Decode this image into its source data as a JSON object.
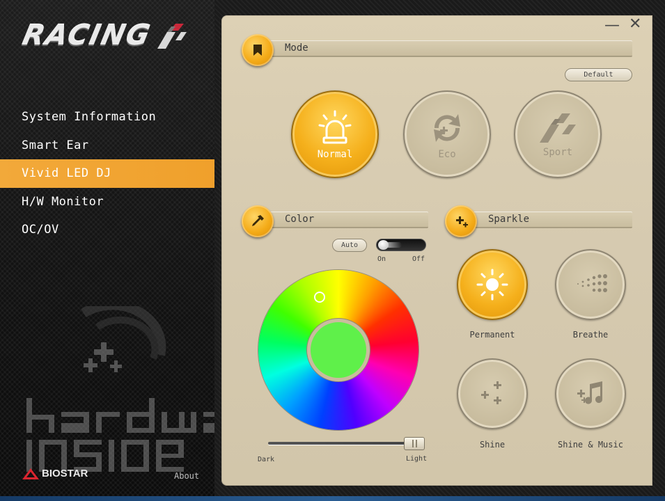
{
  "app": {
    "logo_text": "RACING"
  },
  "sidebar": {
    "items": [
      {
        "label": "System Information",
        "active": false
      },
      {
        "label": "Smart Ear",
        "active": false
      },
      {
        "label": "Vivid LED DJ",
        "active": true
      },
      {
        "label": "H/W Monitor",
        "active": false
      },
      {
        "label": "OC/OV",
        "active": false
      }
    ],
    "brand": "BIOSTAR",
    "about": "About",
    "watermark": "hardware inside"
  },
  "window": {
    "minimize": "—",
    "close": "✕"
  },
  "mode": {
    "title": "Mode",
    "default_label": "Default",
    "options": [
      {
        "label": "Normal",
        "selected": true
      },
      {
        "label": "Eco",
        "selected": false
      },
      {
        "label": "Sport",
        "selected": false
      }
    ]
  },
  "color": {
    "title": "Color",
    "auto_label": "Auto",
    "toggle_on_label": "On",
    "toggle_off_label": "Off",
    "toggle_state": "on",
    "selected_color": "#5ff04a",
    "brightness_min_label": "Dark",
    "brightness_max_label": "Light",
    "brightness": 0.95
  },
  "sparkle": {
    "title": "Sparkle",
    "options": [
      {
        "label": "Permanent",
        "selected": true
      },
      {
        "label": "Breathe",
        "selected": false
      },
      {
        "label": "Shine",
        "selected": false
      },
      {
        "label": "Shine & Music",
        "selected": false
      }
    ]
  },
  "colors": {
    "accent": "#f2a93a",
    "panel": "#d8ccb0"
  }
}
